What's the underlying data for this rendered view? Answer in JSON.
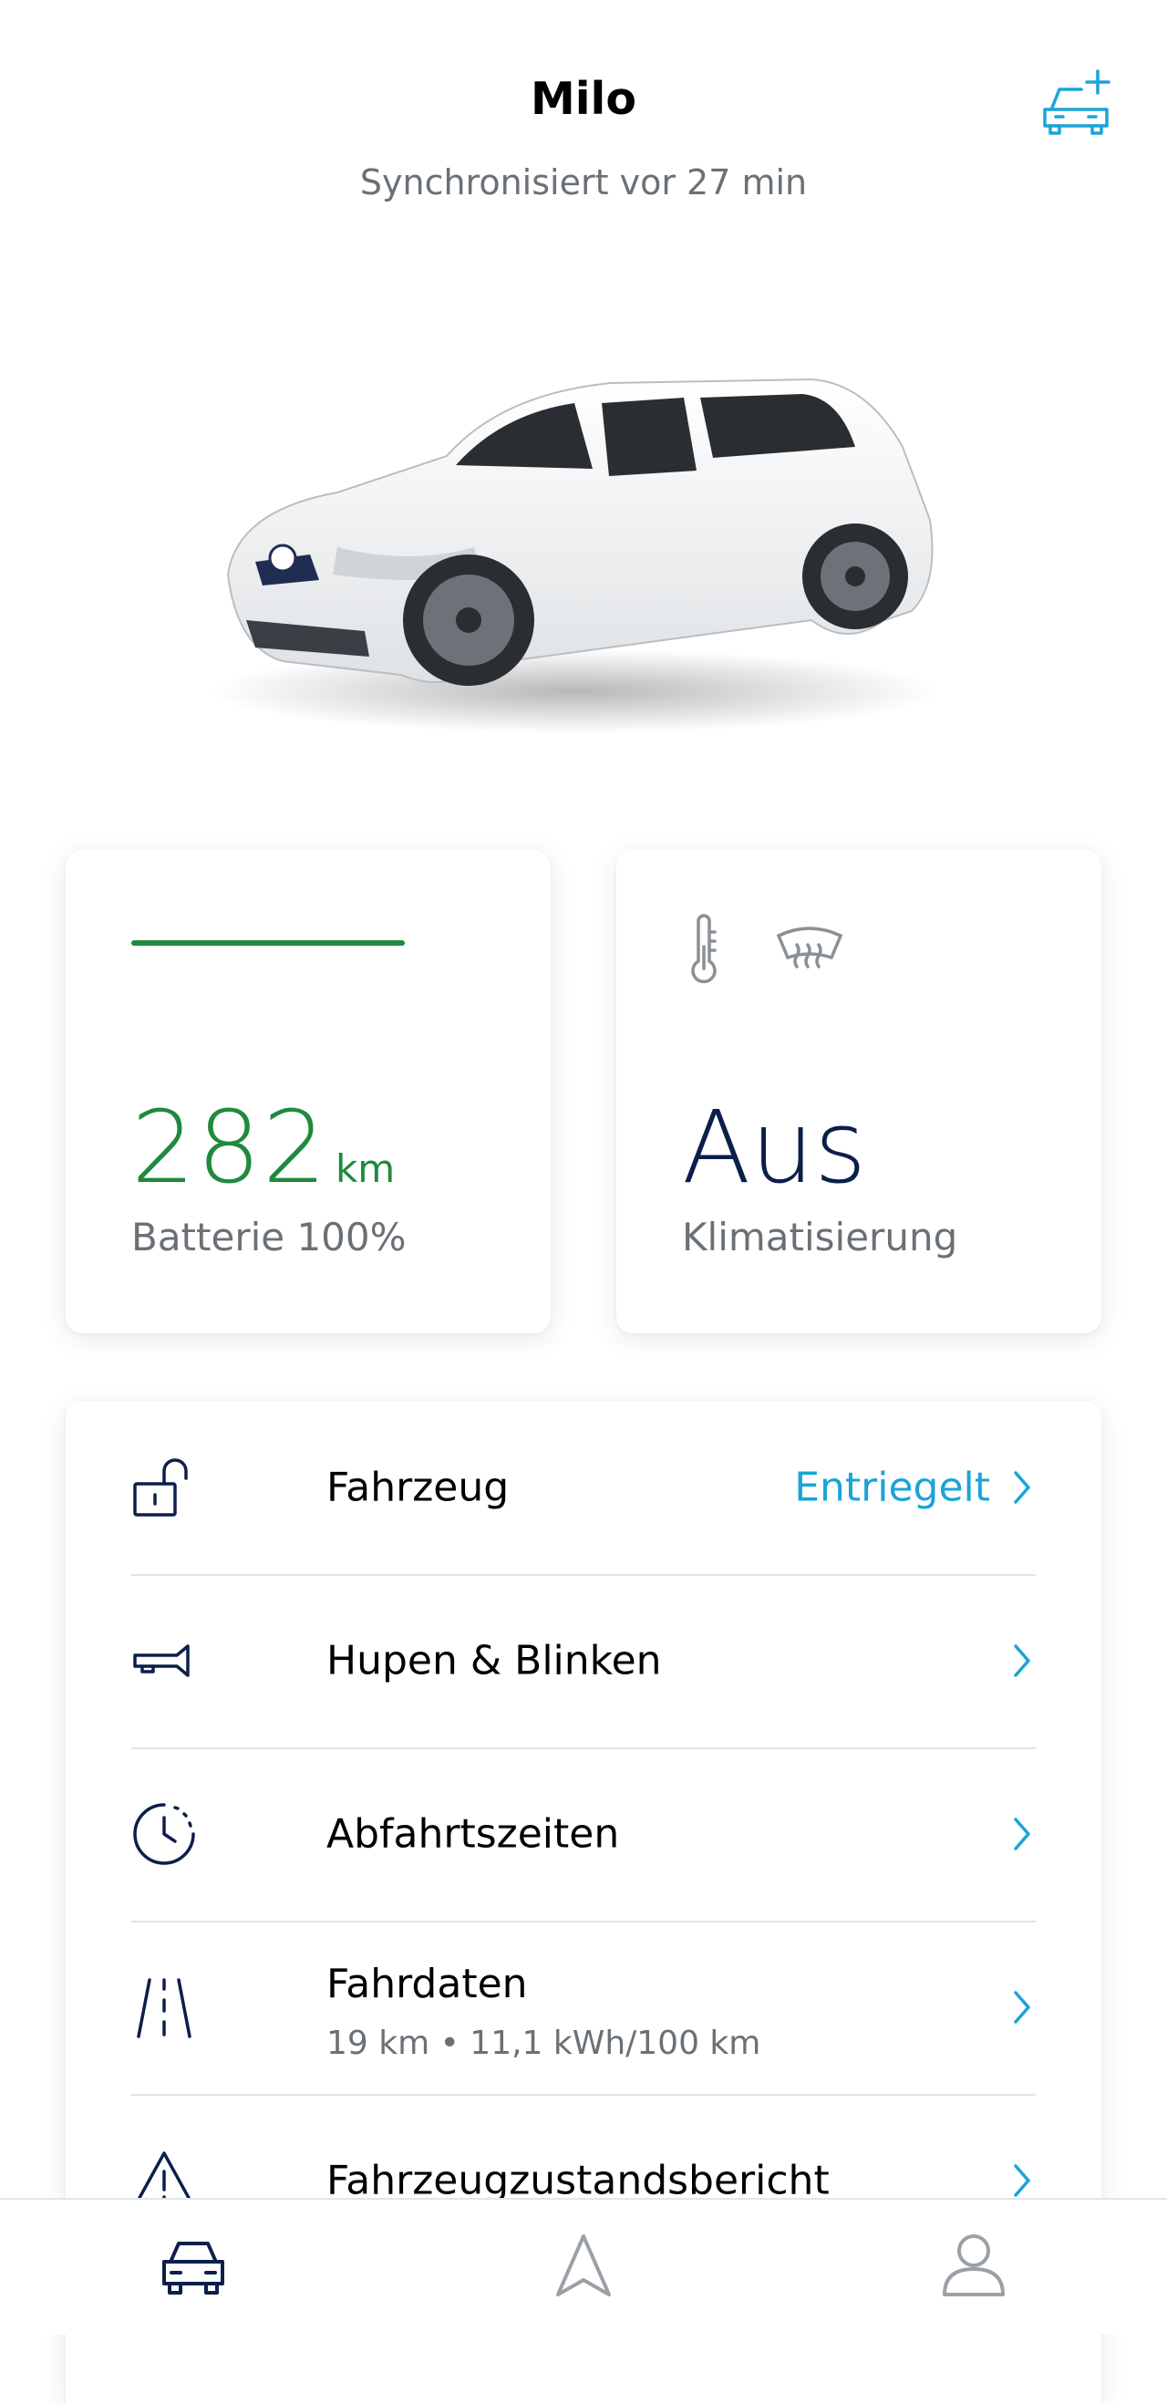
{
  "header": {
    "title": "Milo",
    "subtitle": "Synchronisiert vor 27 min",
    "add_vehicle_icon": "car-plus-icon"
  },
  "vehicle_image": "white-vw-e-golf",
  "battery_card": {
    "range_value": "282",
    "range_unit": "km",
    "label": "Batterie 100%",
    "charge_level": 1.0,
    "color": "#1f8a3c"
  },
  "climate_card": {
    "icons": [
      "thermometer-icon",
      "rear-window-heating-icon"
    ],
    "value": "Aus",
    "label": "Klimatisierung"
  },
  "menu": {
    "items": [
      {
        "icon": "unlocked-padlock-icon",
        "label": "Fahrzeug",
        "value": "Entriegelt"
      },
      {
        "icon": "horn-icon",
        "label": "Hupen & Blinken"
      },
      {
        "icon": "clock-icon",
        "label": "Abfahrtszeiten"
      },
      {
        "icon": "road-icon",
        "label": "Fahrdaten",
        "sublabel": "19 km • 11,1 kWh/100 km"
      },
      {
        "icon": "warning-triangle-icon",
        "label": "Fahrzeugzustandsbericht"
      }
    ]
  },
  "tabbar": {
    "tabs": [
      {
        "icon": "car-icon",
        "active": true
      },
      {
        "icon": "navigation-arrow-icon",
        "active": false
      },
      {
        "icon": "profile-icon",
        "active": false
      }
    ]
  },
  "colors": {
    "accent": "#1aa4d8",
    "green": "#1f8a3c",
    "navy": "#0c1f4a",
    "grey_text": "#6a7076"
  }
}
